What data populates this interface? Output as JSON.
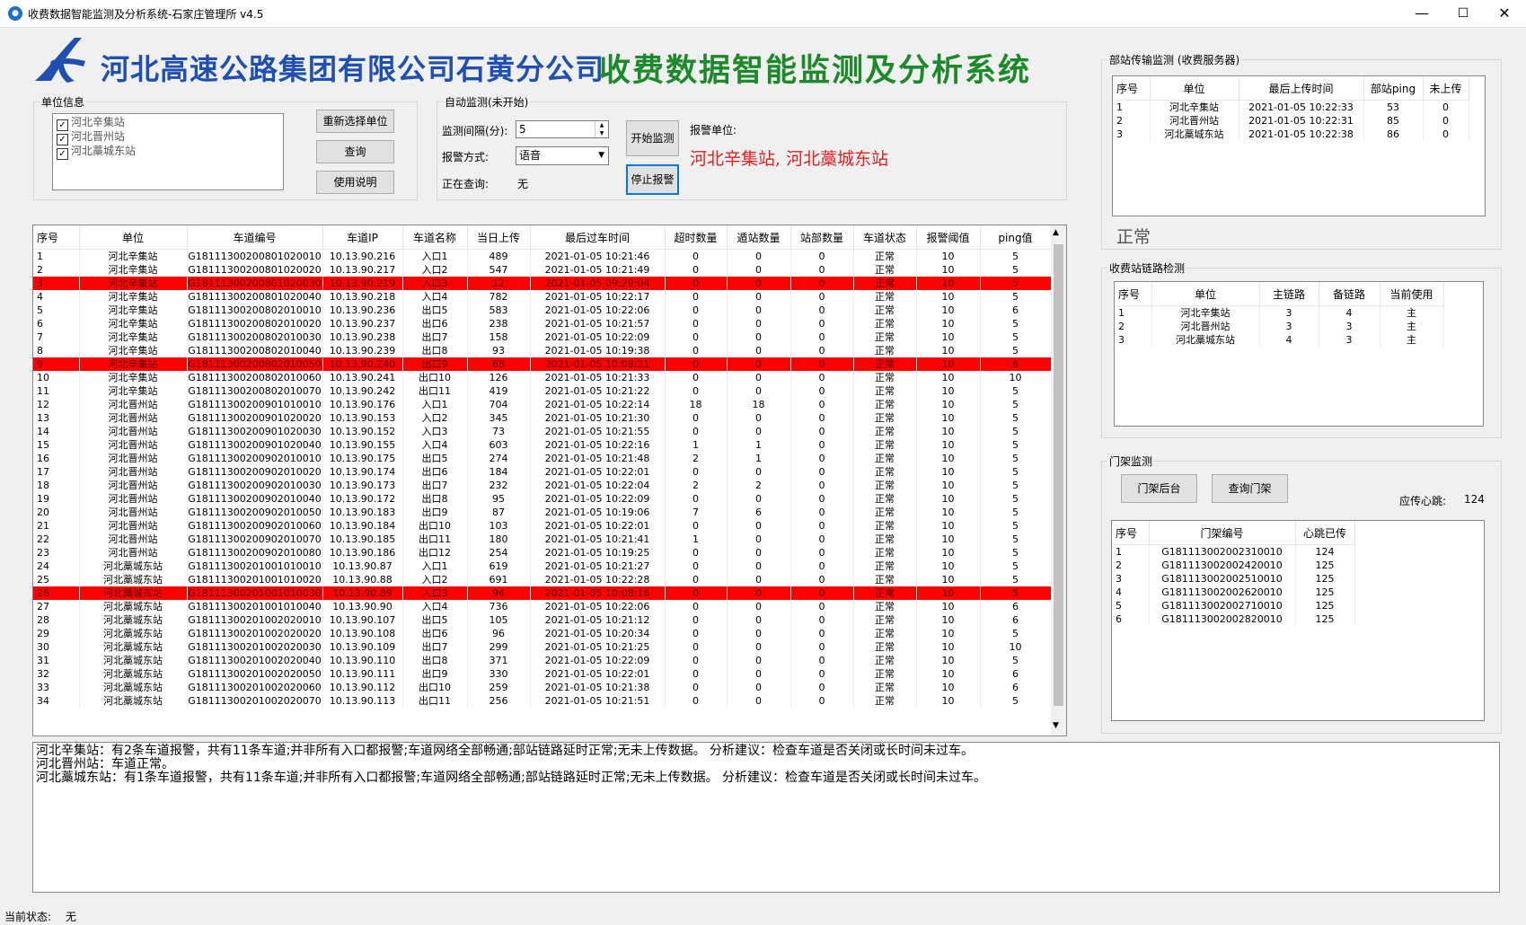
{
  "window": {
    "title": "收费数据智能监测及分析系统-石家庄管理所 v4.5",
    "minimize": "—",
    "maximize": "☐",
    "close": "✕"
  },
  "header": {
    "company": "河北高速公路集团有限公司石黄分公司",
    "system_title": "收费数据智能监测及分析系统"
  },
  "unit_info": {
    "legend": "单位信息",
    "items": [
      "河北辛集站",
      "河北晋州站",
      "河北藁城东站"
    ],
    "reselect_button": "重新选择单位",
    "query_button": "查询",
    "help_button": "使用说明"
  },
  "auto_monitor": {
    "legend": "自动监测(未开始)",
    "interval_label": "监测间隔(分):",
    "interval_value": "5",
    "alarm_mode_label": "报警方式:",
    "alarm_mode_value": "语音",
    "querying_label": "正在查询:",
    "querying_value": "无",
    "start_button": "开始监测",
    "stop_button": "停止报警",
    "alarm_unit_label": "报警单位:",
    "alarm_units": "河北辛集站, 河北藁城东站"
  },
  "lane_table": {
    "columns": [
      "序号",
      "单位",
      "车道编号",
      "车道IP",
      "车道名称",
      "当日上传",
      "最后过车时间",
      "超时数量",
      "遁站数量",
      "站部数量",
      "车道状态",
      "报警阈值",
      "ping值"
    ],
    "rows": [
      {
        "no": "1",
        "unit": "河北辛集站",
        "code": "G18111300200801020010",
        "ip": "10.13.90.216",
        "name": "入口1",
        "upload": "489",
        "time": "2021-01-05 10:21:46",
        "timeout": "0",
        "escape": "0",
        "station": "0",
        "status": "正常",
        "threshold": "10",
        "ping": "5",
        "alarm": false
      },
      {
        "no": "2",
        "unit": "河北辛集站",
        "code": "G18111300200801020020",
        "ip": "10.13.90.217",
        "name": "入口2",
        "upload": "547",
        "time": "2021-01-05 10:21:49",
        "timeout": "0",
        "escape": "0",
        "station": "0",
        "status": "正常",
        "threshold": "10",
        "ping": "5",
        "alarm": false
      },
      {
        "no": "3",
        "unit": "河北辛集站",
        "code": "G18111300200801020030",
        "ip": "10.13.90.219",
        "name": "入口3",
        "upload": "12",
        "time": "2021-01-05 09:29:04",
        "timeout": "0",
        "escape": "0",
        "station": "0",
        "status": "正常",
        "threshold": "10",
        "ping": "5",
        "alarm": true
      },
      {
        "no": "4",
        "unit": "河北辛集站",
        "code": "G18111300200801020040",
        "ip": "10.13.90.218",
        "name": "入口4",
        "upload": "782",
        "time": "2021-01-05 10:22:17",
        "timeout": "0",
        "escape": "0",
        "station": "0",
        "status": "正常",
        "threshold": "10",
        "ping": "5",
        "alarm": false
      },
      {
        "no": "5",
        "unit": "河北辛集站",
        "code": "G18111300200802010010",
        "ip": "10.13.90.236",
        "name": "出口5",
        "upload": "583",
        "time": "2021-01-05 10:22:06",
        "timeout": "0",
        "escape": "0",
        "station": "0",
        "status": "正常",
        "threshold": "10",
        "ping": "6",
        "alarm": false
      },
      {
        "no": "6",
        "unit": "河北辛集站",
        "code": "G18111300200802010020",
        "ip": "10.13.90.237",
        "name": "出口6",
        "upload": "238",
        "time": "2021-01-05 10:21:57",
        "timeout": "0",
        "escape": "0",
        "station": "0",
        "status": "正常",
        "threshold": "10",
        "ping": "5",
        "alarm": false
      },
      {
        "no": "7",
        "unit": "河北辛集站",
        "code": "G18111300200802010030",
        "ip": "10.13.90.238",
        "name": "出口7",
        "upload": "158",
        "time": "2021-01-05 10:22:09",
        "timeout": "0",
        "escape": "0",
        "station": "0",
        "status": "正常",
        "threshold": "10",
        "ping": "5",
        "alarm": false
      },
      {
        "no": "8",
        "unit": "河北辛集站",
        "code": "G18111300200802010040",
        "ip": "10.13.90.239",
        "name": "出口8",
        "upload": "93",
        "time": "2021-01-05 10:19:38",
        "timeout": "0",
        "escape": "0",
        "station": "0",
        "status": "正常",
        "threshold": "10",
        "ping": "5",
        "alarm": false
      },
      {
        "no": "9",
        "unit": "河北辛集站",
        "code": "G18111300200802010050",
        "ip": "10.13.90.240",
        "name": "出口9",
        "upload": "68",
        "time": "2021-01-05 10:08:21",
        "timeout": "0",
        "escape": "0",
        "station": "0",
        "status": "正常",
        "threshold": "10",
        "ping": "6",
        "alarm": true
      },
      {
        "no": "10",
        "unit": "河北辛集站",
        "code": "G18111300200802010060",
        "ip": "10.13.90.241",
        "name": "出口10",
        "upload": "126",
        "time": "2021-01-05 10:21:33",
        "timeout": "0",
        "escape": "0",
        "station": "0",
        "status": "正常",
        "threshold": "10",
        "ping": "10",
        "alarm": false
      },
      {
        "no": "11",
        "unit": "河北辛集站",
        "code": "G18111300200802010070",
        "ip": "10.13.90.242",
        "name": "出口11",
        "upload": "419",
        "time": "2021-01-05 10:21:22",
        "timeout": "0",
        "escape": "0",
        "station": "0",
        "status": "正常",
        "threshold": "10",
        "ping": "5",
        "alarm": false
      },
      {
        "no": "12",
        "unit": "河北晋州站",
        "code": "G18111300200901010010",
        "ip": "10.13.90.176",
        "name": "入口1",
        "upload": "704",
        "time": "2021-01-05 10:22:14",
        "timeout": "18",
        "escape": "18",
        "station": "0",
        "status": "正常",
        "threshold": "10",
        "ping": "5",
        "alarm": false
      },
      {
        "no": "13",
        "unit": "河北晋州站",
        "code": "G18111300200901020020",
        "ip": "10.13.90.153",
        "name": "入口2",
        "upload": "345",
        "time": "2021-01-05 10:21:30",
        "timeout": "0",
        "escape": "0",
        "station": "0",
        "status": "正常",
        "threshold": "10",
        "ping": "5",
        "alarm": false
      },
      {
        "no": "14",
        "unit": "河北晋州站",
        "code": "G18111300200901020030",
        "ip": "10.13.90.152",
        "name": "入口3",
        "upload": "73",
        "time": "2021-01-05 10:21:55",
        "timeout": "0",
        "escape": "0",
        "station": "0",
        "status": "正常",
        "threshold": "10",
        "ping": "5",
        "alarm": false
      },
      {
        "no": "15",
        "unit": "河北晋州站",
        "code": "G18111300200901020040",
        "ip": "10.13.90.155",
        "name": "入口4",
        "upload": "603",
        "time": "2021-01-05 10:22:16",
        "timeout": "1",
        "escape": "1",
        "station": "0",
        "status": "正常",
        "threshold": "10",
        "ping": "5",
        "alarm": false
      },
      {
        "no": "16",
        "unit": "河北晋州站",
        "code": "G18111300200902010010",
        "ip": "10.13.90.175",
        "name": "出口5",
        "upload": "274",
        "time": "2021-01-05 10:21:48",
        "timeout": "2",
        "escape": "1",
        "station": "0",
        "status": "正常",
        "threshold": "10",
        "ping": "5",
        "alarm": false
      },
      {
        "no": "17",
        "unit": "河北晋州站",
        "code": "G18111300200902010020",
        "ip": "10.13.90.174",
        "name": "出口6",
        "upload": "184",
        "time": "2021-01-05 10:22:01",
        "timeout": "0",
        "escape": "0",
        "station": "0",
        "status": "正常",
        "threshold": "10",
        "ping": "5",
        "alarm": false
      },
      {
        "no": "18",
        "unit": "河北晋州站",
        "code": "G18111300200902010030",
        "ip": "10.13.90.173",
        "name": "出口7",
        "upload": "232",
        "time": "2021-01-05 10:22:04",
        "timeout": "2",
        "escape": "2",
        "station": "0",
        "status": "正常",
        "threshold": "10",
        "ping": "5",
        "alarm": false
      },
      {
        "no": "19",
        "unit": "河北晋州站",
        "code": "G18111300200902010040",
        "ip": "10.13.90.172",
        "name": "出口8",
        "upload": "95",
        "time": "2021-01-05 10:22:09",
        "timeout": "0",
        "escape": "0",
        "station": "0",
        "status": "正常",
        "threshold": "10",
        "ping": "5",
        "alarm": false
      },
      {
        "no": "20",
        "unit": "河北晋州站",
        "code": "G18111300200902010050",
        "ip": "10.13.90.183",
        "name": "出口9",
        "upload": "87",
        "time": "2021-01-05 10:19:06",
        "timeout": "7",
        "escape": "6",
        "station": "0",
        "status": "正常",
        "threshold": "10",
        "ping": "5",
        "alarm": false
      },
      {
        "no": "21",
        "unit": "河北晋州站",
        "code": "G18111300200902010060",
        "ip": "10.13.90.184",
        "name": "出口10",
        "upload": "103",
        "time": "2021-01-05 10:22:01",
        "timeout": "0",
        "escape": "0",
        "station": "0",
        "status": "正常",
        "threshold": "10",
        "ping": "5",
        "alarm": false
      },
      {
        "no": "22",
        "unit": "河北晋州站",
        "code": "G18111300200902010070",
        "ip": "10.13.90.185",
        "name": "出口11",
        "upload": "180",
        "time": "2021-01-05 10:21:41",
        "timeout": "1",
        "escape": "0",
        "station": "0",
        "status": "正常",
        "threshold": "10",
        "ping": "5",
        "alarm": false
      },
      {
        "no": "23",
        "unit": "河北晋州站",
        "code": "G18111300200902010080",
        "ip": "10.13.90.186",
        "name": "出口12",
        "upload": "254",
        "time": "2021-01-05 10:19:25",
        "timeout": "0",
        "escape": "0",
        "station": "0",
        "status": "正常",
        "threshold": "10",
        "ping": "5",
        "alarm": false
      },
      {
        "no": "24",
        "unit": "河北藁城东站",
        "code": "G18111300201001010010",
        "ip": "10.13.90.87",
        "name": "入口1",
        "upload": "619",
        "time": "2021-01-05 10:21:27",
        "timeout": "0",
        "escape": "0",
        "station": "0",
        "status": "正常",
        "threshold": "10",
        "ping": "5",
        "alarm": false
      },
      {
        "no": "25",
        "unit": "河北藁城东站",
        "code": "G18111300201001010020",
        "ip": "10.13.90.88",
        "name": "入口2",
        "upload": "691",
        "time": "2021-01-05 10:22:28",
        "timeout": "0",
        "escape": "0",
        "station": "0",
        "status": "正常",
        "threshold": "10",
        "ping": "5",
        "alarm": false
      },
      {
        "no": "26",
        "unit": "河北藁城东站",
        "code": "G18111300201001010030",
        "ip": "10.13.90.89",
        "name": "入口3",
        "upload": "94",
        "time": "2021-01-05 10:08:16",
        "timeout": "0",
        "escape": "0",
        "station": "0",
        "status": "正常",
        "threshold": "10",
        "ping": "5",
        "alarm": true
      },
      {
        "no": "27",
        "unit": "河北藁城东站",
        "code": "G18111300201001010040",
        "ip": "10.13.90.90",
        "name": "入口4",
        "upload": "736",
        "time": "2021-01-05 10:22:06",
        "timeout": "0",
        "escape": "0",
        "station": "0",
        "status": "正常",
        "threshold": "10",
        "ping": "6",
        "alarm": false
      },
      {
        "no": "28",
        "unit": "河北藁城东站",
        "code": "G18111300201002020010",
        "ip": "10.13.90.107",
        "name": "出口5",
        "upload": "105",
        "time": "2021-01-05 10:21:12",
        "timeout": "0",
        "escape": "0",
        "station": "0",
        "status": "正常",
        "threshold": "10",
        "ping": "6",
        "alarm": false
      },
      {
        "no": "29",
        "unit": "河北藁城东站",
        "code": "G18111300201002020020",
        "ip": "10.13.90.108",
        "name": "出口6",
        "upload": "96",
        "time": "2021-01-05 10:20:34",
        "timeout": "0",
        "escape": "0",
        "station": "0",
        "status": "正常",
        "threshold": "10",
        "ping": "5",
        "alarm": false
      },
      {
        "no": "30",
        "unit": "河北藁城东站",
        "code": "G18111300201002020030",
        "ip": "10.13.90.109",
        "name": "出口7",
        "upload": "299",
        "time": "2021-01-05 10:21:25",
        "timeout": "0",
        "escape": "0",
        "station": "0",
        "status": "正常",
        "threshold": "10",
        "ping": "10",
        "alarm": false
      },
      {
        "no": "31",
        "unit": "河北藁城东站",
        "code": "G18111300201002020040",
        "ip": "10.13.90.110",
        "name": "出口8",
        "upload": "371",
        "time": "2021-01-05 10:22:09",
        "timeout": "0",
        "escape": "0",
        "station": "0",
        "status": "正常",
        "threshold": "10",
        "ping": "5",
        "alarm": false
      },
      {
        "no": "32",
        "unit": "河北藁城东站",
        "code": "G18111300201002020050",
        "ip": "10.13.90.111",
        "name": "出口9",
        "upload": "330",
        "time": "2021-01-05 10:22:01",
        "timeout": "0",
        "escape": "0",
        "station": "0",
        "status": "正常",
        "threshold": "10",
        "ping": "6",
        "alarm": false
      },
      {
        "no": "33",
        "unit": "河北藁城东站",
        "code": "G18111300201002020060",
        "ip": "10.13.90.112",
        "name": "出口10",
        "upload": "259",
        "time": "2021-01-05 10:21:38",
        "timeout": "0",
        "escape": "0",
        "station": "0",
        "status": "正常",
        "threshold": "10",
        "ping": "6",
        "alarm": false
      },
      {
        "no": "34",
        "unit": "河北藁城东站",
        "code": "G18111300201002020070",
        "ip": "10.13.90.113",
        "name": "出口11",
        "upload": "256",
        "time": "2021-01-05 10:21:51",
        "timeout": "0",
        "escape": "0",
        "station": "0",
        "status": "正常",
        "threshold": "10",
        "ping": "5",
        "alarm": false
      }
    ]
  },
  "analysis_text": [
    "河北辛集站：有2条车道报警，共有11条车道;并非所有入口都报警;车道网络全部畅通;部站链路延时正常;无未上传数据。 分析建议：检查车道是否关闭或长时间未过车。",
    "河北晋州站：车道正常。",
    "河北藁城东站：有1条车道报警，共有11条车道;并非所有入口都报警;车道网络全部畅通;部站链路延时正常;无未上传数据。 分析建议：检查车道是否关闭或长时间未过车。"
  ],
  "status_bar": {
    "label": "当前状态:",
    "value": "无"
  },
  "transmission": {
    "legend": "部站传输监测 (收费服务器)",
    "columns": [
      "序号",
      "单位",
      "最后上传时间",
      "部站ping",
      "未上传"
    ],
    "rows": [
      [
        "1",
        "河北辛集站",
        "2021-01-05 10:22:33",
        "53",
        "0"
      ],
      [
        "2",
        "河北晋州站",
        "2021-01-05 10:22:31",
        "85",
        "0"
      ],
      [
        "3",
        "河北藁城东站",
        "2021-01-05 10:22:38",
        "86",
        "0"
      ]
    ],
    "status": "正常"
  },
  "link_check": {
    "legend": "收费站链路检测",
    "columns": [
      "序号",
      "单位",
      "主链路",
      "备链路",
      "当前使用"
    ],
    "rows": [
      [
        "1",
        "河北辛集站",
        "3",
        "4",
        "主"
      ],
      [
        "2",
        "河北晋州站",
        "3",
        "3",
        "主"
      ],
      [
        "3",
        "河北藁城东站",
        "4",
        "3",
        "主"
      ]
    ]
  },
  "gantry": {
    "legend": "门架监测",
    "backend_button": "门架后台",
    "query_button": "查询门架",
    "heartbeat_label": "应传心跳:",
    "heartbeat_value": "124",
    "columns": [
      "序号",
      "门架编号",
      "心跳已传"
    ],
    "rows": [
      [
        "1",
        "G181113002002310010",
        "124"
      ],
      [
        "2",
        "G181113002002420010",
        "125"
      ],
      [
        "3",
        "G181113002002510010",
        "125"
      ],
      [
        "4",
        "G181113002002620010",
        "125"
      ],
      [
        "5",
        "G181113002002710010",
        "125"
      ],
      [
        "6",
        "G181113002002820010",
        "125"
      ]
    ]
  },
  "colors": {
    "alarm_row": "#ff0000",
    "company_blue": "#1f4fb0",
    "title_green": "#1c8a2a",
    "alarm_text": "#e02020"
  }
}
